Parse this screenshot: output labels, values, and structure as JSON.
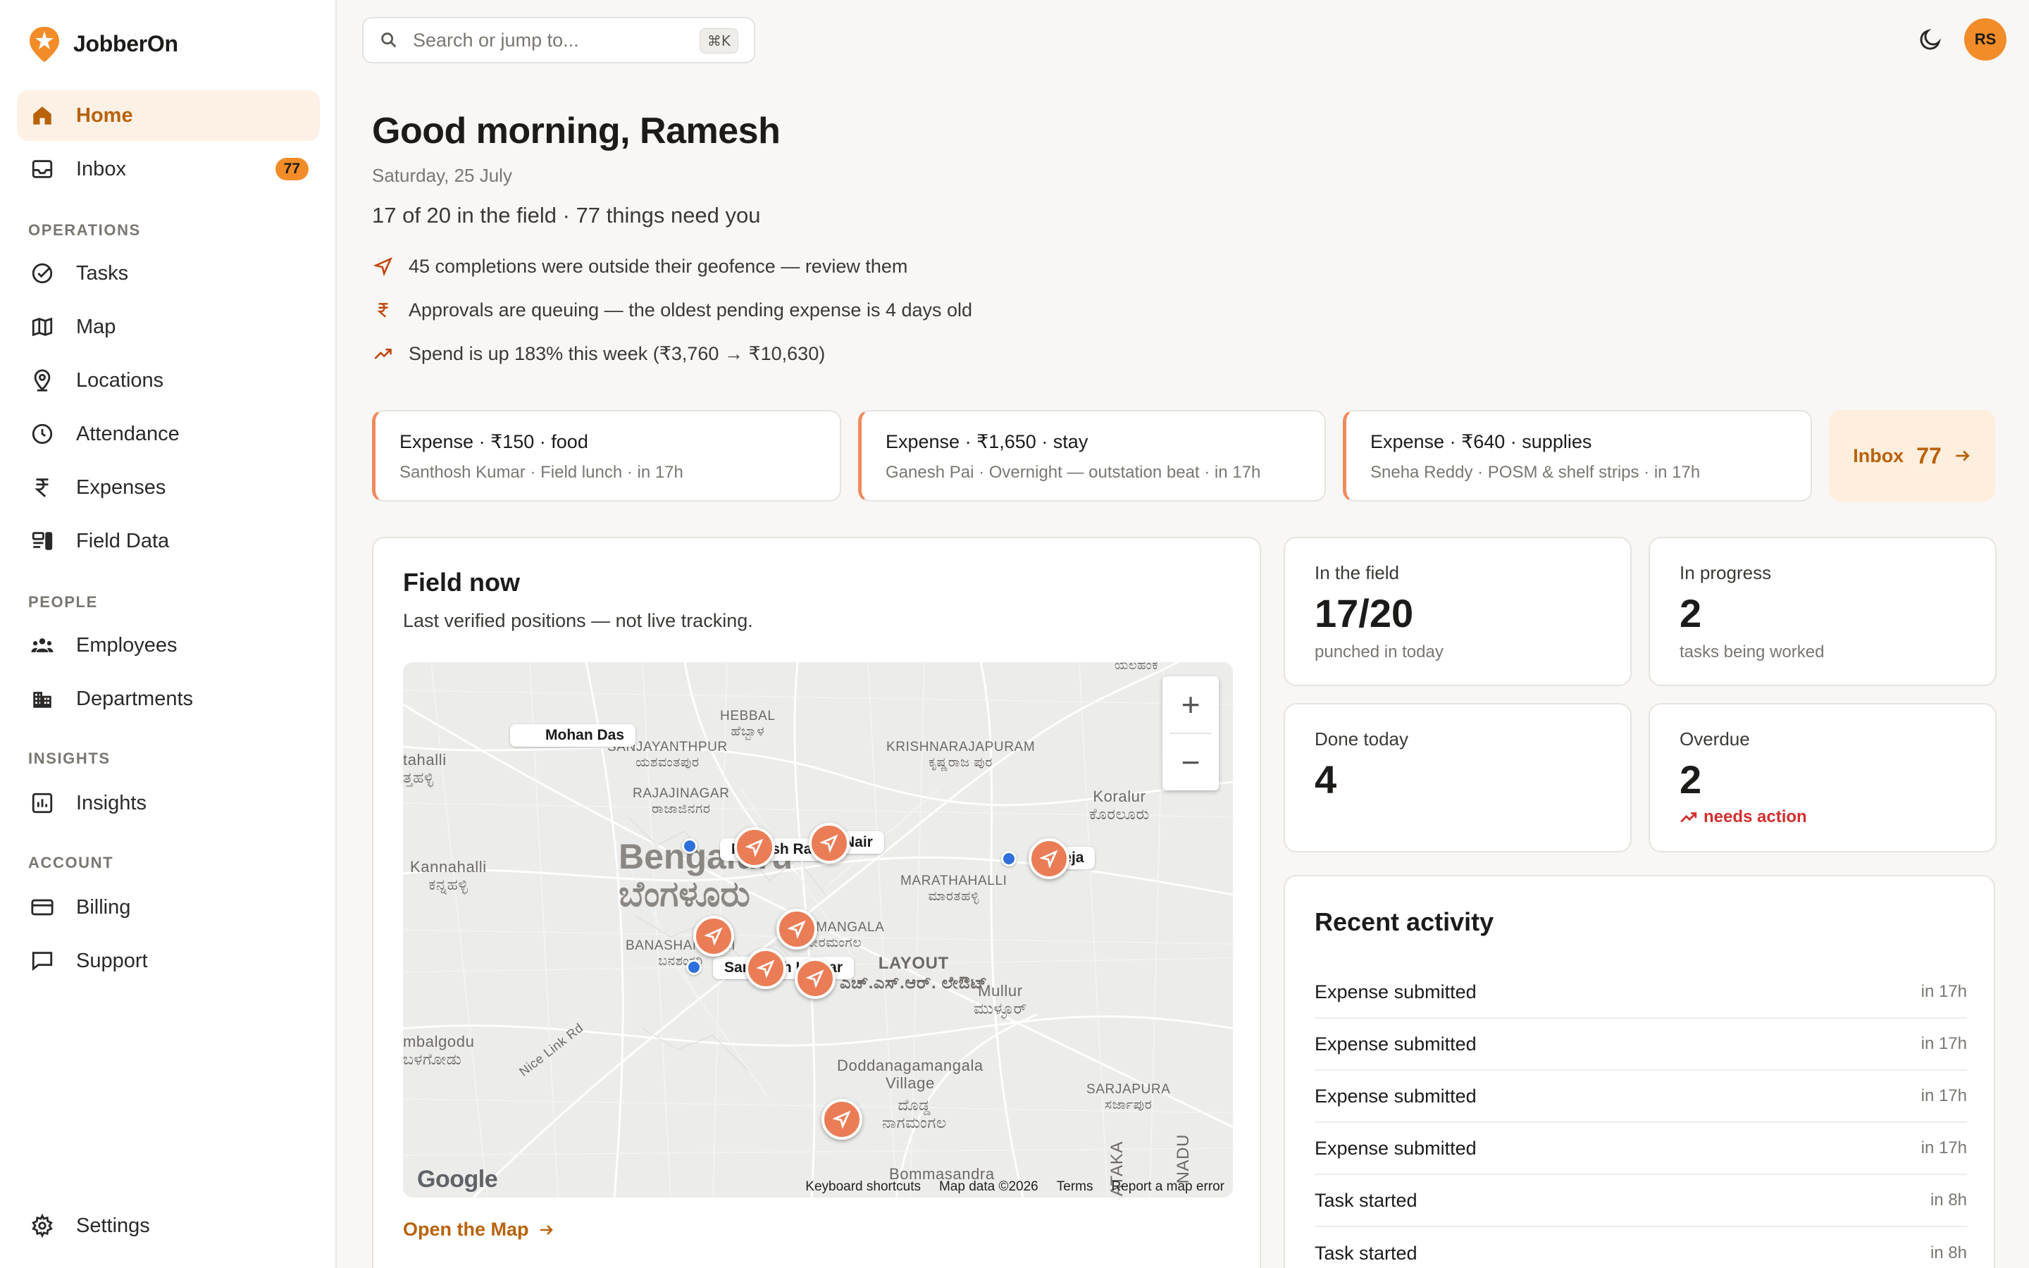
{
  "app": {
    "name": "JobberOn"
  },
  "sidebar": {
    "home": "Home",
    "inbox": "Inbox",
    "inbox_count": "77",
    "sections": {
      "operations": "OPERATIONS",
      "people": "PEOPLE",
      "insights": "INSIGHTS",
      "account": "ACCOUNT"
    },
    "tasks": "Tasks",
    "map": "Map",
    "locations": "Locations",
    "attendance": "Attendance",
    "expenses": "Expenses",
    "field_data": "Field Data",
    "employees": "Employees",
    "departments": "Departments",
    "insights_item": "Insights",
    "billing": "Billing",
    "support": "Support",
    "settings": "Settings"
  },
  "header": {
    "search_placeholder": "Search or jump to...",
    "search_shortcut": "⌘K",
    "avatar_initials": "RS"
  },
  "greeting": {
    "title": "Good morning, Ramesh",
    "date": "Saturday, 25 July",
    "summary": "17 of 20 in the field · 77 things need you",
    "insights": [
      "45 completions were outside their geofence — review them",
      "Approvals are queuing — the oldest pending expense is 4 days old",
      "Spend is up 183% this week (₹3,760 → ₹10,630)"
    ]
  },
  "expense_cards": [
    {
      "title": "Expense · ₹150 · food",
      "sub": "Santhosh Kumar · Field lunch · in 17h"
    },
    {
      "title": "Expense · ₹1,650 · stay",
      "sub": "Ganesh Pai · Overnight — outstation beat · in 17h"
    },
    {
      "title": "Expense · ₹640 · supplies",
      "sub": "Sneha Reddy · POSM & shelf strips · in 17h"
    }
  ],
  "inbox_card": {
    "label": "Inbox",
    "count": "77"
  },
  "field_now": {
    "title": "Field now",
    "subtitle": "Last verified positions — not live tracking.",
    "open_map": "Open the Map",
    "map": {
      "city_en": "Bengaluru",
      "city_kn": "ಬೆಂಗಳೂರು",
      "places": {
        "hebbal": "HEBBAL",
        "hebbal_kn": "ಹೆಬ್ಬಾಳ",
        "sanjay": "SANJAYANTHPUR",
        "sanjay_kn": "ಯಶವಂತಪುರ",
        "rajaji": "RAJAJINAGAR",
        "rajaji_kn": "ರಾಜಾಜಿನಗರ",
        "krishna": "KRISHNARAJAPURAM",
        "krishna_kn": "ಕೃಷ್ಣರಾಜ\nಪುರ",
        "koralur": "Koralur",
        "koralur_kn": "ಕೊರಲೂರು",
        "kannahalli": "Kannahalli",
        "kannahalli_kn": "ಕನ್ನಹಳ್ಳಿ",
        "tahalli": "tahalli",
        "tahalli_kn": "ತ್ತಹಳ್ಳಿ",
        "marathahalli": "MARATHAHALLI",
        "marathahalli_kn": "ಮಾರತಹಳ್ಳಿ",
        "banashankari": "BANASHANKARI",
        "banashankari_kn": "ಬನಶಂಕರಿ",
        "koramangala": "KORAMANGALA",
        "koramangala_kn": "ಕೋರಮಂಗಲ",
        "layout": "LAYOUT",
        "layout_kn": "ಎಚ್.ಎಸ್.ಆರ್.\nಲೇಔಟ್",
        "mullur": "Mullur",
        "mullur_kn": "ಮುಳ್ಳೂರ್",
        "umbalgodu": "mbalgodu",
        "umbalgodu_kn": "ಬಳಗೋಡು",
        "doddanag": "Doddanagamangala\nVillage",
        "doddanag_kn": "ದೊಡ್ಡ\nನಾಗಮಂಗಲ",
        "sarjapura": "SARJAPURA",
        "sarjapura_kn": "ಸರ್ಜಾಪುರ",
        "bommasandra": "Bommasandra",
        "karnataka": "KATAKA",
        "tamil": "NADU",
        "nice_road": "Nice Link Rd",
        "top_right": "ಯಲಹಂಕ"
      },
      "labels": {
        "mohan": "Mohan Das",
        "prakash": "Prakash Rao",
        "nair": "Nair",
        "teja": "Teja",
        "santhosh": "Santhosh Kumar"
      },
      "google": "Google",
      "footer": [
        "Keyboard shortcuts",
        "Map data ©2026",
        "Terms",
        "Report a map error"
      ]
    }
  },
  "stats": [
    {
      "label": "In the field",
      "value": "17/20",
      "sub": "punched in today"
    },
    {
      "label": "In progress",
      "value": "2",
      "sub": "tasks being worked"
    },
    {
      "label": "Done today",
      "value": "4",
      "sub": ""
    },
    {
      "label": "Overdue",
      "value": "2",
      "sub": "needs action"
    }
  ],
  "activity": {
    "title": "Recent activity",
    "rows": [
      {
        "text": "Expense submitted",
        "when": "in 17h"
      },
      {
        "text": "Expense submitted",
        "when": "in 17h"
      },
      {
        "text": "Expense submitted",
        "when": "in 17h"
      },
      {
        "text": "Expense submitted",
        "when": "in 17h"
      },
      {
        "text": "Task started",
        "when": "in 8h"
      },
      {
        "text": "Task started",
        "when": "in 8h"
      }
    ]
  },
  "colors": {
    "accent": "#f28c28",
    "accent_text": "#b8620a",
    "pin": "#ea7d56",
    "danger": "#d22f2f"
  }
}
